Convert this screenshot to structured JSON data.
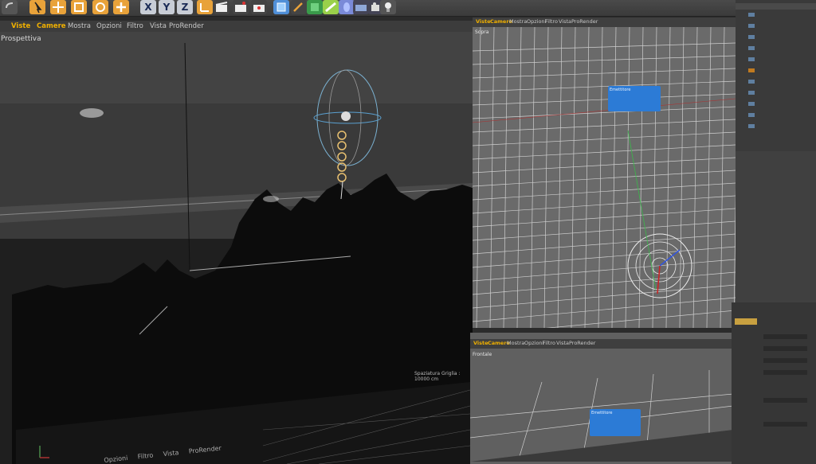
{
  "toolbar": {
    "x_label": "X",
    "y_label": "Y",
    "z_label": "Z"
  },
  "viewport_perspective": {
    "menu": [
      "Viste",
      "Camere",
      "Mostra",
      "Opzioni",
      "Filtro",
      "Vista",
      "ProRender"
    ],
    "label": "Prospettiva",
    "grid_spacing": "Spaziatura Griglia : 10000 cm"
  },
  "viewport_perspective_bottom_menu": [
    "Opzioni",
    "Filtro",
    "Vista",
    "ProRender"
  ],
  "viewport_top": {
    "menu": [
      "Viste",
      "Camere",
      "Mostra",
      "Opzioni",
      "Filtro",
      "Vista",
      "ProRender"
    ],
    "label": "Sopra",
    "tooltip_title": "Emettitore"
  },
  "viewport_bottom": {
    "menu": [
      "Viste",
      "Camere",
      "Mostra",
      "Opzioni",
      "Filtro",
      "Vista",
      "ProRender"
    ],
    "label": "Frontale",
    "tooltip_title": "Emettitore"
  },
  "colors": {
    "active_menu": "#f0b000",
    "tooltip_blue": "#2c7bd6",
    "toolbar_orange": "#e8a23a"
  }
}
